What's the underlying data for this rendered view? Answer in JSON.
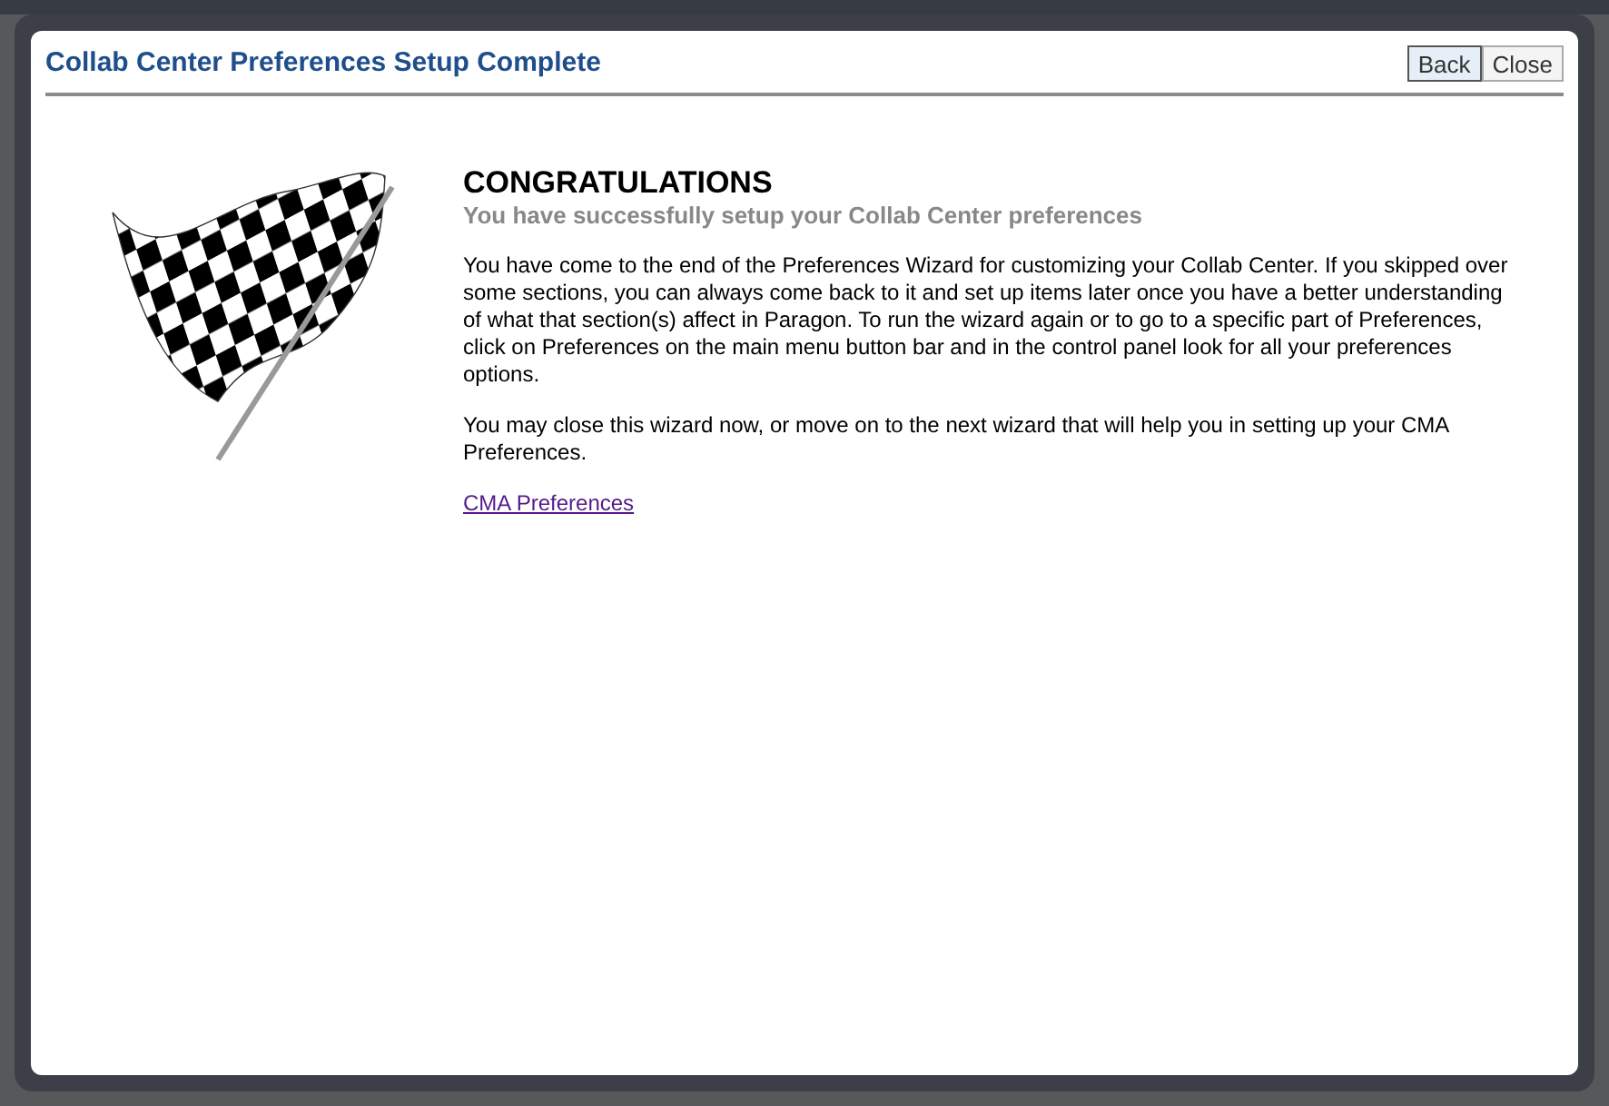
{
  "dialog": {
    "title": "Collab Center Preferences Setup Complete",
    "buttons": [
      {
        "label": "Back",
        "selected": true
      },
      {
        "label": "Close",
        "selected": false
      }
    ]
  },
  "content": {
    "heading": "CONGRATULATIONS",
    "subheading": "You have successfully setup your Collab Center preferences",
    "paragraphs": [
      "You have come to the end of the Preferences Wizard for customizing your Collab Center. If you skipped over some sections, you can always come back to it and set up items later once you have a better understanding of what that section(s) affect in Paragon. To run the wizard again or to go to a specific part of Preferences, click on Preferences on the main menu button bar and in the control panel look for all your preferences options.",
      "You may close this wizard now, or move on to the next wizard that will help you in setting up your CMA Preferences."
    ],
    "link": "CMA Preferences"
  }
}
